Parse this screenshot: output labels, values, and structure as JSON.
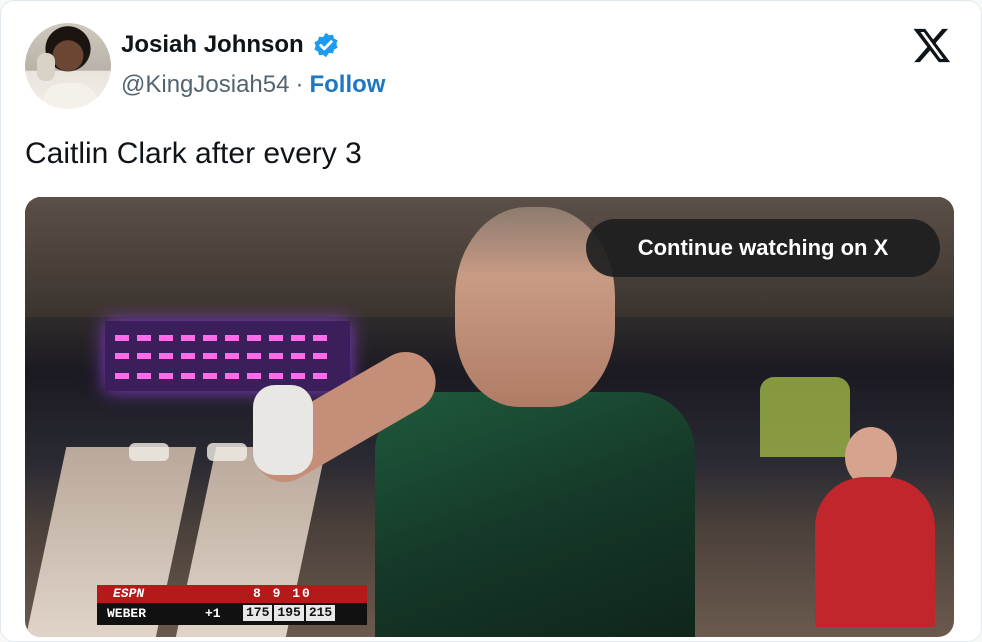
{
  "author": {
    "name": "Josiah Johnson",
    "handle": "@KingJosiah54",
    "separator": "·",
    "follow_label": "Follow",
    "verified_icon": "verified-badge-icon",
    "avatar_icon": "profile-avatar"
  },
  "brand": {
    "logo_icon": "x-logo-icon"
  },
  "tweet": {
    "text": "Caitlin Clark after every 3"
  },
  "media": {
    "overlay_button": "Continue watching on X",
    "scorebug": {
      "network": "ESPN",
      "frame_labels": "8   9   10",
      "player": "WEBER",
      "diff": "+1",
      "scores": [
        "175",
        "195",
        "215"
      ]
    }
  },
  "colors": {
    "link": "#1d78c1",
    "verified": "#1d9bf0",
    "text_primary": "#0f1419",
    "text_secondary": "#536471"
  }
}
